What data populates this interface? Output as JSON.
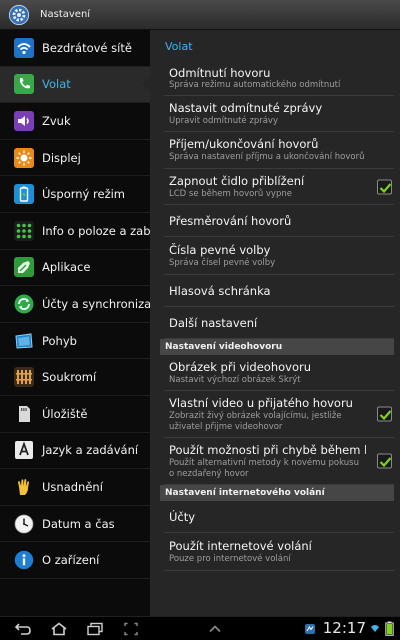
{
  "app": {
    "title": "Nastavení"
  },
  "sidebar": {
    "items": [
      {
        "label": "Bezdrátové sítě",
        "icon": "wifi-icon"
      },
      {
        "label": "Volat",
        "icon": "phone-icon",
        "selected": true
      },
      {
        "label": "Zvuk",
        "icon": "sound-icon"
      },
      {
        "label": "Displej",
        "icon": "display-icon"
      },
      {
        "label": "Úsporný režim",
        "icon": "power-saving-icon"
      },
      {
        "label": "Info o poloze a zab",
        "icon": "location-security-icon"
      },
      {
        "label": "Aplikace",
        "icon": "applications-icon"
      },
      {
        "label": "Účty a synchroniza",
        "icon": "sync-icon"
      },
      {
        "label": "Pohyb",
        "icon": "motion-icon"
      },
      {
        "label": "Soukromí",
        "icon": "privacy-icon"
      },
      {
        "label": "Úložiště",
        "icon": "storage-icon"
      },
      {
        "label": "Jazyk a zadávání",
        "icon": "language-icon"
      },
      {
        "label": "Usnadnění",
        "icon": "accessibility-icon"
      },
      {
        "label": "Datum a čas",
        "icon": "clock-icon"
      },
      {
        "label": "O zařízení",
        "icon": "info-icon"
      }
    ]
  },
  "main": {
    "title": "Volat",
    "items": [
      {
        "title": "Odmítnutí hovoru",
        "subtitle": "Správa režimu automatického odmítnutí"
      },
      {
        "title": "Nastavit odmítnuté zprávy",
        "subtitle": "Upravit odmítnuté zprávy"
      },
      {
        "title": "Příjem/ukončování hovorů",
        "subtitle": "Správa nastavení příjmu a ukončování hovorů"
      },
      {
        "title": "Zapnout čidlo přiblížení",
        "subtitle": "LCD se během hovorů vypne",
        "checked": true
      },
      {
        "title": "Přesměrování hovorů"
      },
      {
        "title": "Čísla pevné volby",
        "subtitle": "Správa čísel pevné volby"
      },
      {
        "title": "Hlasová schránka"
      },
      {
        "title": "Další nastavení"
      }
    ],
    "video_section": {
      "header": "Nastavení videohovoru",
      "items": [
        {
          "title": "Obrázek při videohovoru",
          "subtitle": "Nastavit výchozí obrázek Skrýt"
        },
        {
          "title": "Vlastní video u přijatého hovoru",
          "subtitle": "Zobrazit živý obrázek volajícímu, jestliže uživatel přijme videohovor",
          "checked": true
        },
        {
          "title": "Použít možnosti při chybě během hovoru",
          "subtitle": "Použít alternativní metody k novému pokusu o nezdařený hovor",
          "checked": true
        }
      ]
    },
    "internet_section": {
      "header": "Nastavení internetového volání",
      "items": [
        {
          "title": "Účty"
        },
        {
          "title": "Použít internetové volání",
          "subtitle": "Pouze pro internetové volání"
        }
      ]
    }
  },
  "statusbar": {
    "time": "12:17"
  },
  "colors": {
    "accent": "#3fb4ea",
    "checkmark": "#7ed321",
    "content_bg": "#262626",
    "sidebar_bg": "#0b0b0b"
  }
}
